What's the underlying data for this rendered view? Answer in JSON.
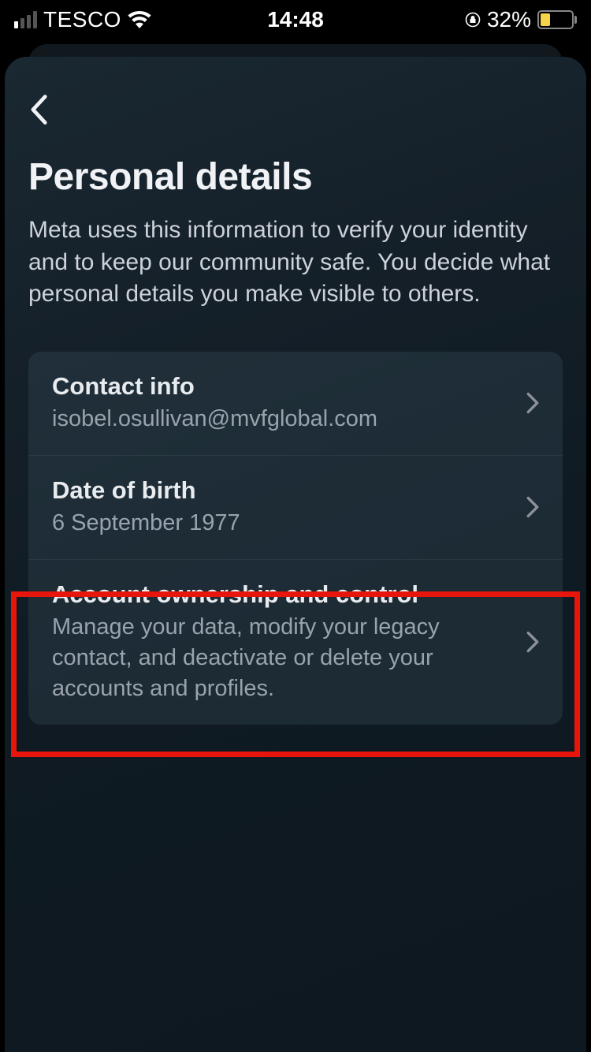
{
  "status_bar": {
    "carrier": "TESCO",
    "time": "14:48",
    "battery_percent": "32%"
  },
  "page": {
    "title": "Personal details",
    "subtitle": "Meta uses this information to verify your identity and to keep our community safe. You decide what personal details you make visible to others."
  },
  "rows": {
    "contact": {
      "title": "Contact info",
      "value": "isobel.osullivan@mvfglobal.com"
    },
    "dob": {
      "title": "Date of birth",
      "value": "6 September 1977"
    },
    "ownership": {
      "title": "Account ownership and control",
      "subtitle": "Manage your data, modify your legacy contact, and deactivate or delete your accounts and profiles."
    }
  }
}
